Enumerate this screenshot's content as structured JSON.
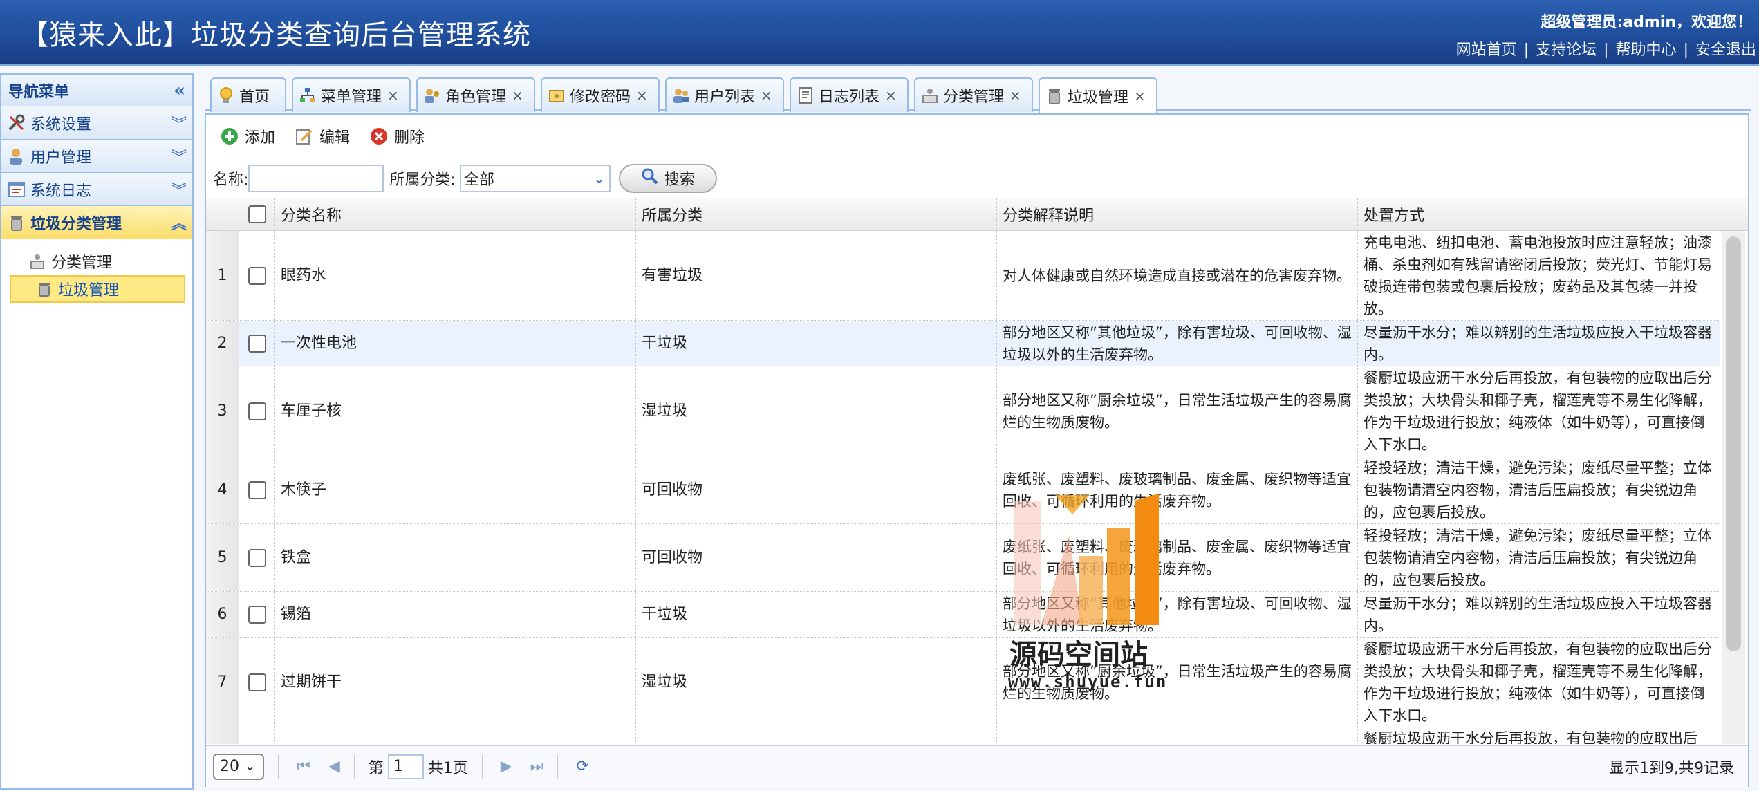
{
  "header": {
    "title": "【猿来入此】垃圾分类查询后台管理系统",
    "user_greeting": "超级管理员:admin，欢迎您！",
    "links": [
      "网站首页",
      "支持论坛",
      "帮助中心",
      "安全退出"
    ],
    "separator": "|"
  },
  "sidebar": {
    "title": "导航菜单",
    "collapse_symbol": "«",
    "menus": [
      {
        "label": "系统设置",
        "chevron": "︾"
      },
      {
        "label": "用户管理",
        "chevron": "︾"
      },
      {
        "label": "系统日志",
        "chevron": "︾"
      },
      {
        "label": "垃圾分类管理",
        "chevron": "︽"
      }
    ],
    "sub_items": [
      {
        "label": "分类管理"
      },
      {
        "label": "垃圾管理"
      }
    ]
  },
  "tabs": [
    {
      "label": "首页",
      "icon": "lightbulb-icon"
    },
    {
      "label": "菜单管理",
      "icon": "sitemap-icon"
    },
    {
      "label": "角色管理",
      "icon": "role-users-icon"
    },
    {
      "label": "修改密码",
      "icon": "password-icon"
    },
    {
      "label": "用户列表",
      "icon": "users-icon"
    },
    {
      "label": "日志列表",
      "icon": "log-document-icon"
    },
    {
      "label": "分类管理",
      "icon": "category-icon"
    },
    {
      "label": "垃圾管理",
      "icon": "trash-can-icon"
    }
  ],
  "tab_close": "×",
  "toolbar": {
    "add": "添加",
    "edit": "编辑",
    "delete": "删除"
  },
  "search": {
    "name_label": "名称:",
    "name_value": "",
    "category_label": "所属分类:",
    "category_value": "全部",
    "button": "搜索"
  },
  "grid": {
    "columns": [
      "分类名称",
      "所属分类",
      "分类解释说明",
      "处置方式"
    ],
    "rows": [
      {
        "n": "1",
        "name": "眼药水",
        "category": "有害垃圾",
        "explain": "对人体健康或自然环境造成直接或潜在的危害废弃物。",
        "disposal": "充电电池、纽扣电池、蓄电池投放时应注意轻放；油漆桶、杀虫剂如有残留请密闭后投放；荧光灯、节能灯易破损连带包装或包裹后投放；废药品及其包装一并投放。"
      },
      {
        "n": "2",
        "name": "一次性电池",
        "category": "干垃圾",
        "explain": "部分地区又称”其他垃圾”，除有害垃圾、可回收物、湿垃圾以外的生活废弃物。",
        "disposal": "尽量沥干水分；难以辨别的生活垃圾应投入干垃圾容器内。"
      },
      {
        "n": "3",
        "name": "车厘子核",
        "category": "湿垃圾",
        "explain": "部分地区又称”厨余垃圾”，日常生活垃圾产生的容易腐烂的生物质废物。",
        "disposal": "餐厨垃圾应沥干水分后再投放，有包装物的应取出后分类投放；大块骨头和椰子壳，榴莲壳等不易生化降解，作为干垃圾进行投放；纯液体（如牛奶等），可直接倒入下水口。"
      },
      {
        "n": "4",
        "name": "木筷子",
        "category": "可回收物",
        "explain": "废纸张、废塑料、废玻璃制品、废金属、废织物等适宜回收、可循环利用的生活废弃物。",
        "disposal": "轻投轻放；清洁干燥，避免污染；废纸尽量平整；立体包装物请清空内容物，清洁后压扁投放；有尖锐边角的，应包裹后投放。"
      },
      {
        "n": "5",
        "name": "铁盒",
        "category": "可回收物",
        "explain": "废纸张、废塑料、废玻璃制品、废金属、废织物等适宜回收、可循环利用的生活废弃物。",
        "disposal": "轻投轻放；清洁干燥，避免污染；废纸尽量平整；立体包装物请清空内容物，清洁后压扁投放；有尖锐边角的，应包裹后投放。"
      },
      {
        "n": "6",
        "name": "锡箔",
        "category": "干垃圾",
        "explain": "部分地区又称”其他垃圾”，除有害垃圾、可回收物、湿垃圾以外的生活废弃物。",
        "disposal": "尽量沥干水分；难以辨别的生活垃圾应投入干垃圾容器内。"
      },
      {
        "n": "7",
        "name": "过期饼干",
        "category": "湿垃圾",
        "explain": "部分地区又称”厨余垃圾”，日常生活垃圾产生的容易腐烂的生物质废物。",
        "disposal": "餐厨垃圾应沥干水分后再投放，有包装物的应取出后分类投放；大块骨头和椰子壳，榴莲壳等不易生化降解，作为干垃圾进行投放；纯液体（如牛奶等），可直接倒入下水口。"
      },
      {
        "n": "",
        "name": "",
        "category": "",
        "explain": "",
        "disposal": "餐厨垃圾应沥干水分后再投放，有包装物的应取出后"
      }
    ]
  },
  "pager": {
    "page_size": "20",
    "page_prefix": "第",
    "page_value": "1",
    "page_suffix": "共1页",
    "info": "显示1到9,共9记录"
  },
  "watermark": {
    "name": "源码空间站",
    "url": "www.shuyue.fun"
  },
  "colors": {
    "header_bg": "#1f4e9d",
    "border": "#99bbe8",
    "active_menu": "#fbdd6a",
    "row_highlight": "#eaf2fd"
  }
}
